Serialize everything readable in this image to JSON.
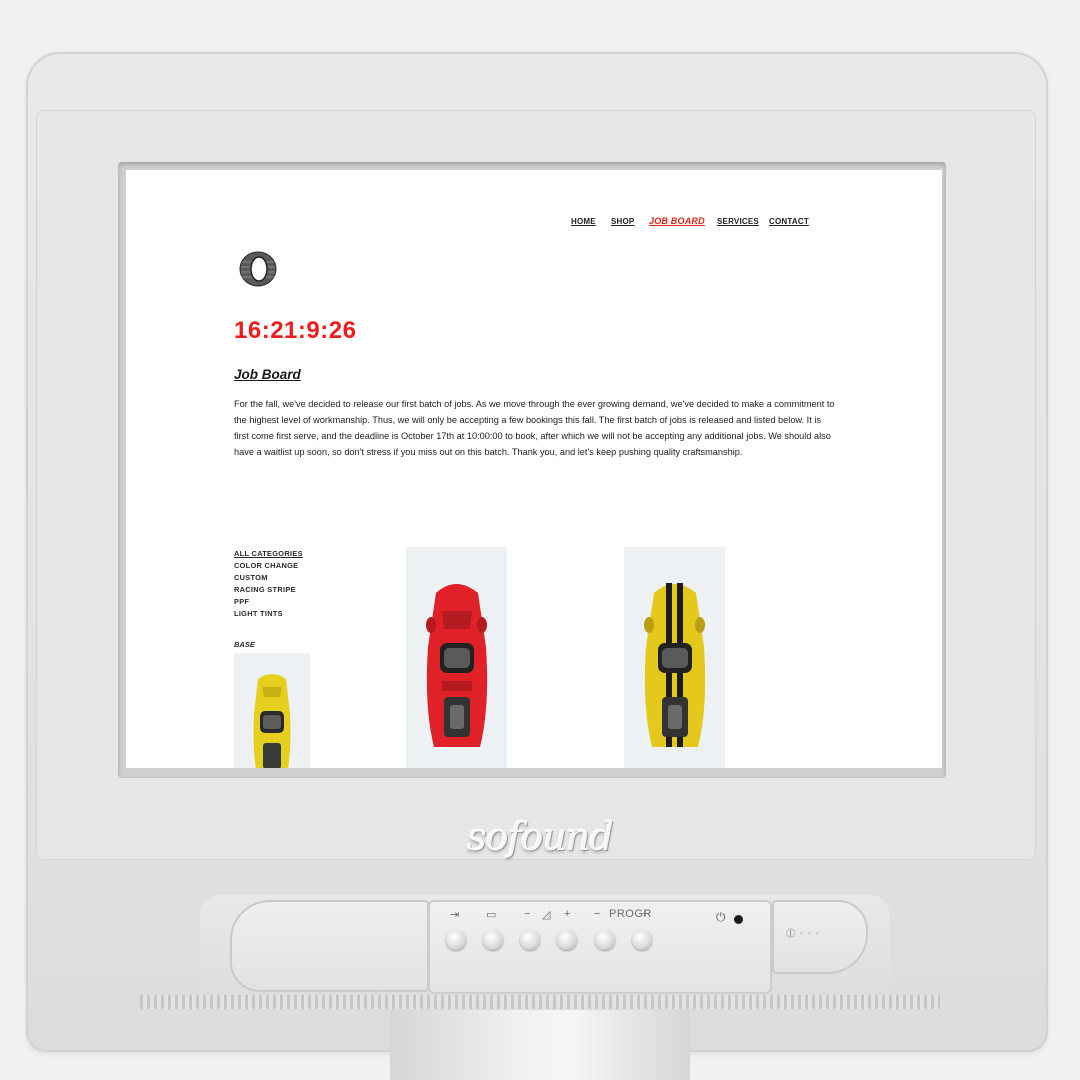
{
  "device": {
    "brand": "sofound",
    "controls": {
      "input_icon": "input-source-icon",
      "av_icon": "av-mode-icon",
      "volume_minus": "−",
      "volume_icon": "volume-icon",
      "volume_plus": "+",
      "program_minus": "−",
      "program_label": "PROGR",
      "program_plus": "+",
      "power_icon": "power-icon"
    }
  },
  "site": {
    "nav": [
      {
        "label": "HOME"
      },
      {
        "label": "SHOP"
      },
      {
        "label": "JOB BOARD"
      },
      {
        "label": "SERVICES"
      },
      {
        "label": "CONTACT"
      }
    ],
    "logo_icon": "tire-logo-icon",
    "countdown": "16:21:9:26",
    "title": "Job Board",
    "intro": "For the fall, we've decided to release our first batch of jobs. As we move through the ever growing demand, we've decided to make a commitment to the highest level of workmanship. Thus, we will only be accepting a few bookings this fall. The first batch of jobs is released and listed below. It is first come first serve, and the deadline is October 17th at 10:00:00 to book, after which we will not be accepting any additional jobs. We should also have a waitlist up soon, so don't stress if you miss out on this batch. Thank you, and let's keep pushing quality craftsmanship.",
    "categories": [
      {
        "label": "ALL CATEGORIES"
      },
      {
        "label": "COLOR CHANGE"
      },
      {
        "label": "CUSTOM"
      },
      {
        "label": "RACING STRIPE"
      },
      {
        "label": "PPF"
      },
      {
        "label": "LIGHT TINTS"
      }
    ],
    "base_label": "BASE",
    "jobs": [
      {
        "color": "#e7cf1e",
        "stripe": "#e7cf1e",
        "name_icon": "yellow-car-image"
      },
      {
        "color": "#e02128",
        "stripe": "#e02128",
        "name_icon": "red-car-image"
      },
      {
        "color": "#e4c81c",
        "stripe": "#1c1c1c",
        "name_icon": "yellow-striped-car-image"
      }
    ]
  },
  "colors": {
    "accent": "#ee1c1c",
    "bezel": "#e6e6e6",
    "screen_bg": "#ffffff"
  }
}
